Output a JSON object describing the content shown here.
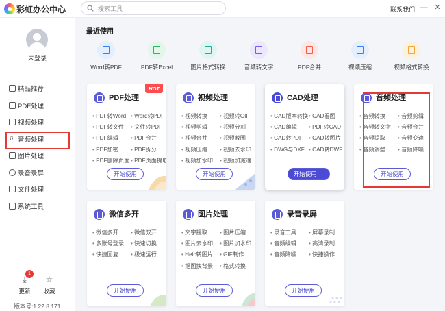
{
  "app": {
    "title": "彩虹办公中心",
    "contact": "联系我们"
  },
  "search": {
    "placeholder": "搜索工具"
  },
  "window_controls": {
    "minimize": "—",
    "close": "✕"
  },
  "user": {
    "status": "未登录"
  },
  "sidebar": {
    "items": [
      {
        "label": "精品推荐",
        "icon": "book-icon"
      },
      {
        "label": "PDF处理",
        "icon": "pdf-icon"
      },
      {
        "label": "视频处理",
        "icon": "video-icon"
      },
      {
        "label": "音频处理",
        "icon": "music-icon"
      },
      {
        "label": "图片处理",
        "icon": "image-icon"
      },
      {
        "label": "录音录屏",
        "icon": "mic-icon"
      },
      {
        "label": "文件处理",
        "icon": "folder-icon"
      },
      {
        "label": "系统工具",
        "icon": "monitor-icon"
      }
    ],
    "update_label": "更新",
    "update_badge": "1",
    "favorite_label": "收藏",
    "version": "版本号:1.22.8.171"
  },
  "recent": {
    "title": "最近使用",
    "tools": [
      {
        "label": "Word转PDF",
        "color": "#3b7ff5",
        "bg": "#e3eefe"
      },
      {
        "label": "PDF转Excel",
        "color": "#2fb46b",
        "bg": "#e2f6ea"
      },
      {
        "label": "图片格式转换",
        "color": "#1fae9b",
        "bg": "#dff5f1"
      },
      {
        "label": "音频转文字",
        "color": "#7a5cf0",
        "bg": "#ece7fd"
      },
      {
        "label": "PDF合并",
        "color": "#f0604f",
        "bg": "#fde6e3"
      },
      {
        "label": "视频压缩",
        "color": "#3b7ff5",
        "bg": "#e3eefe"
      },
      {
        "label": "视频格式转换",
        "color": "#f0a43b",
        "bg": "#fdf1dc"
      }
    ]
  },
  "cards": {
    "pdf": {
      "title": "PDF处理",
      "badge": "HOT",
      "cta": "开始使用",
      "color": "#5b5bd6",
      "items": [
        "PDF转Word",
        "Word转PDF",
        "PDF转文件",
        "文件转PDF",
        "PDF编辑",
        "PDF合并",
        "PDF加密",
        "PDF拆分",
        "PDF删除页面",
        "PDF页面提取"
      ]
    },
    "video": {
      "title": "视频处理",
      "cta": "开始使用",
      "color": "#5b5bd6",
      "items": [
        "视频转换",
        "视频转GIF",
        "视频剪辑",
        "视频分割",
        "视频合并",
        "视频截图",
        "视频压缩",
        "视频去水印",
        "视频加水印",
        "视频加减速"
      ]
    },
    "cad": {
      "title": "CAD处理",
      "cta": "开始使用 →",
      "color": "#4b4bd6",
      "items": [
        "CAD版本转换",
        "CAD看图",
        "CAD编辑",
        "PDF转CAD",
        "CAD转PDF",
        "CAD转图片",
        "DWG与DXF",
        "CAD转DWF"
      ]
    },
    "audio": {
      "title": "音频处理",
      "cta": "开始使用",
      "color": "#5b5bd6",
      "items": [
        "音频转换",
        "音频剪辑",
        "音频转文字",
        "音频合并",
        "音频提取",
        "音频变速",
        "音频调整",
        "音频降噪"
      ]
    },
    "wechat": {
      "title": "微信多开",
      "cta": "开始使用",
      "color": "#5b5bd6",
      "items": [
        "微信多开",
        "微信双开",
        "多账号登录",
        "快速切换",
        "快捷回复",
        "极速运行"
      ]
    },
    "image": {
      "title": "图片处理",
      "cta": "开始使用",
      "color": "#5b5bd6",
      "items": [
        "文字提取",
        "图片压缩",
        "图片去水印",
        "图片加水印",
        "Heic转图片",
        "GIF制作",
        "抠图换背景",
        "格式转换"
      ]
    },
    "record": {
      "title": "录音录屏",
      "cta": "开始使用",
      "color": "#5b5bd6",
      "items": [
        "录音工具",
        "屏幕录制",
        "音频编辑",
        "高清录制",
        "音频降噪",
        "快捷操作"
      ]
    }
  }
}
